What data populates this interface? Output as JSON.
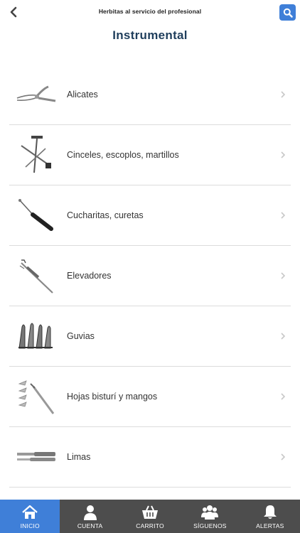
{
  "header": {
    "brand": "Herbitas al servicio del profesional",
    "title": "Instrumental"
  },
  "colors": {
    "accent": "#3f7fd8",
    "tabbar": "#4d4d4d",
    "title": "#1f3e5c"
  },
  "items": [
    {
      "label": "Alicates",
      "icon": "pliers-icon"
    },
    {
      "label": "Cinceles, escoplos, martillos",
      "icon": "chisel-hammer-icon"
    },
    {
      "label": "Cucharitas, curetas",
      "icon": "curette-icon"
    },
    {
      "label": "Elevadores",
      "icon": "elevator-icon"
    },
    {
      "label": "Guvias",
      "icon": "gouge-icon"
    },
    {
      "label": "Hojas bisturí y mangos",
      "icon": "scalpel-icon"
    },
    {
      "label": "Limas",
      "icon": "file-icon"
    }
  ],
  "tabs": [
    {
      "label": "INICIO",
      "icon": "home-icon",
      "active": true
    },
    {
      "label": "CUENTA",
      "icon": "user-icon",
      "active": false
    },
    {
      "label": "CARRITO",
      "icon": "cart-icon",
      "active": false
    },
    {
      "label": "SÍGUENOS",
      "icon": "group-icon",
      "active": false
    },
    {
      "label": "ALERTAS",
      "icon": "bell-icon",
      "active": false
    }
  ]
}
